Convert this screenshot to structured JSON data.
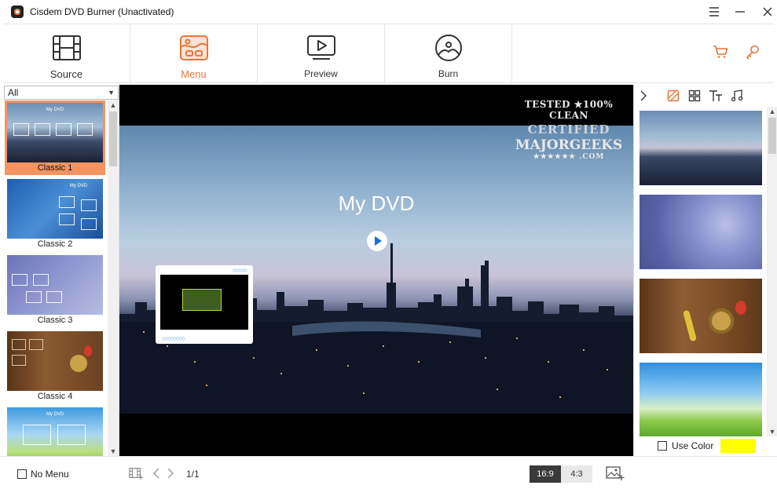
{
  "window": {
    "title": "Cisdem DVD Burner (Unactivated)"
  },
  "toolbar": {
    "tabs": [
      {
        "label": "Source",
        "icon": "film-icon"
      },
      {
        "label": "Menu",
        "icon": "menu-template-icon"
      },
      {
        "label": "Preview",
        "icon": "play-screen-icon"
      },
      {
        "label": "Burn",
        "icon": "disc-icon"
      }
    ],
    "active": "Menu",
    "right_icons": [
      "cart-icon",
      "key-icon"
    ],
    "accent": "#e8763b"
  },
  "templates": {
    "filter": "All",
    "items": [
      {
        "name": "Classic 1",
        "selected": true
      },
      {
        "name": "Classic 2",
        "selected": false
      },
      {
        "name": "Classic 3",
        "selected": false
      },
      {
        "name": "Classic 4",
        "selected": false
      },
      {
        "name": "",
        "selected": false
      }
    ],
    "thumb_title": "My DVD"
  },
  "preview": {
    "title": "My DVD",
    "watermark": {
      "line1": "TESTED ★100% CLEAN",
      "line2": "CERTIFIED",
      "line3": "MAJORGEEKS",
      "line4": "★★★★★★ .COM"
    }
  },
  "right_panel": {
    "tab_icons": [
      "background-icon",
      "layout-icon",
      "text-icon",
      "music-icon"
    ],
    "use_color_label": "Use Color",
    "color": "#ffff00"
  },
  "bottom": {
    "no_menu_label": "No Menu",
    "page": "1/1",
    "ratio_169": "16:9",
    "ratio_43": "4:3"
  }
}
